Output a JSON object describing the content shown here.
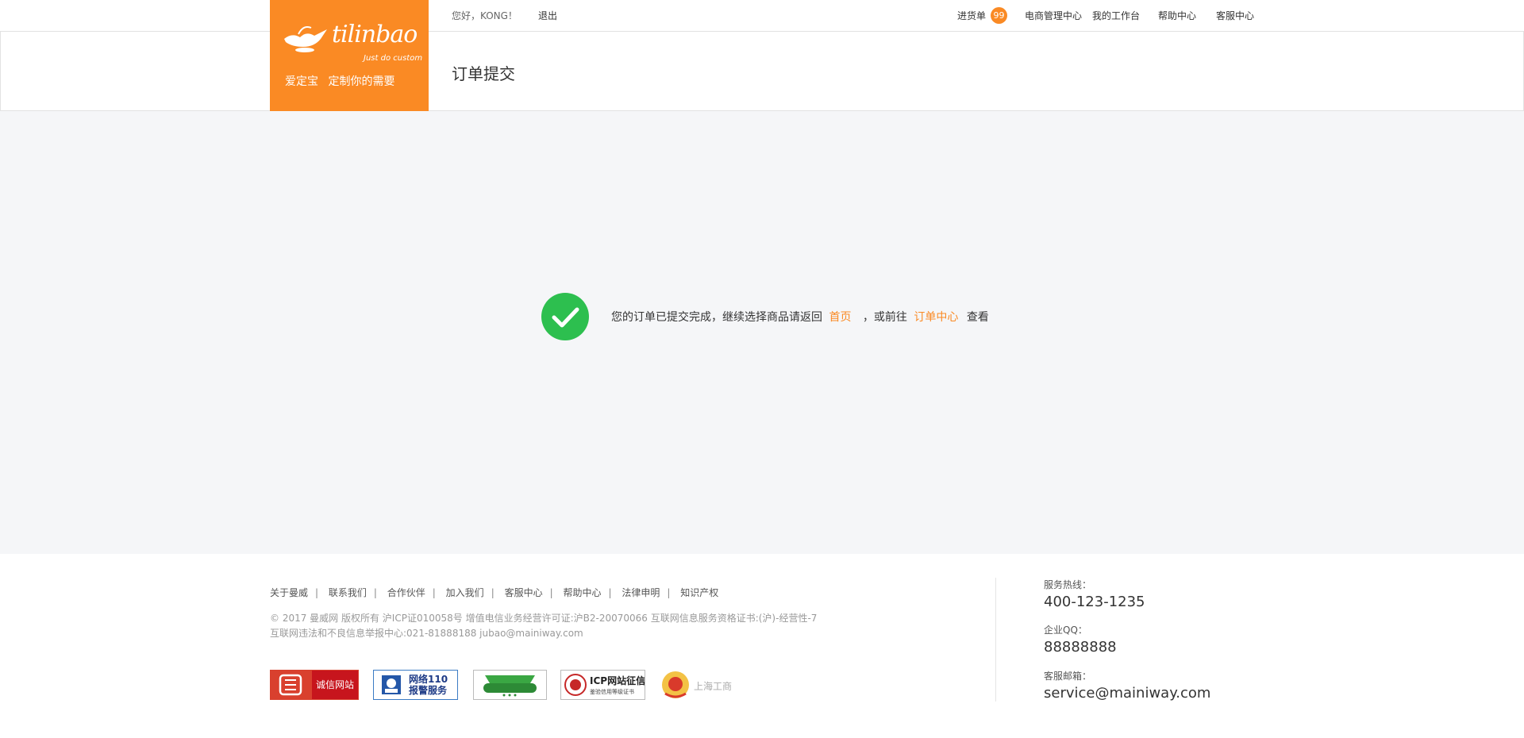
{
  "topbar": {
    "greeting": "您好，KONG！",
    "logout": "退出",
    "cart": "进货单",
    "cart_count": "99",
    "ecommerce": "电商管理中心",
    "workbench": "我的工作台",
    "help": "帮助中心",
    "service": "客服中心"
  },
  "logo": {
    "brand": "tilinbao",
    "tagline": "Just do custom",
    "slogan": "爱定宝  定制你的需要"
  },
  "header": {
    "title": "订单提交"
  },
  "result": {
    "message": "您的订单已提交完成，继续选择商品请返回",
    "home_link": "首页",
    "or_go": "，或前往",
    "order_link": "订单中心",
    "view": "查看"
  },
  "footer": {
    "links": [
      "关于曼威",
      "联系我们",
      "合作伙伴",
      "加入我们",
      "客服中心",
      "帮助中心",
      "法律申明",
      "知识产权"
    ],
    "copyright_line1": "© 2017 曼威网 版权所有  沪ICP证010058号   增值电信业务经营许可证:沪B2-20070066      互联网信息服务资格证书:(沪)-经营性-7",
    "copyright_line2": "互联网违法和不良信息举报中心:021-81888188 jubao@mainiway.com",
    "badges": {
      "integrity": "诚信网站",
      "police": "网络110\n报警服务",
      "icp_title": "ICP网站征信",
      "icp_sub": "鉴验信用等级证书",
      "shanghai": "上海工商"
    },
    "contact": {
      "hotline_label": "服务热线：",
      "hotline": "400-123-1235",
      "qq_label": "企业QQ：",
      "qq": "88888888",
      "email_label": "客服邮箱：",
      "email": "service@mainiway.com"
    }
  },
  "colors": {
    "accent": "#fa8a24",
    "success": "#2dbf4f",
    "main_bg": "#f5f6f8"
  }
}
